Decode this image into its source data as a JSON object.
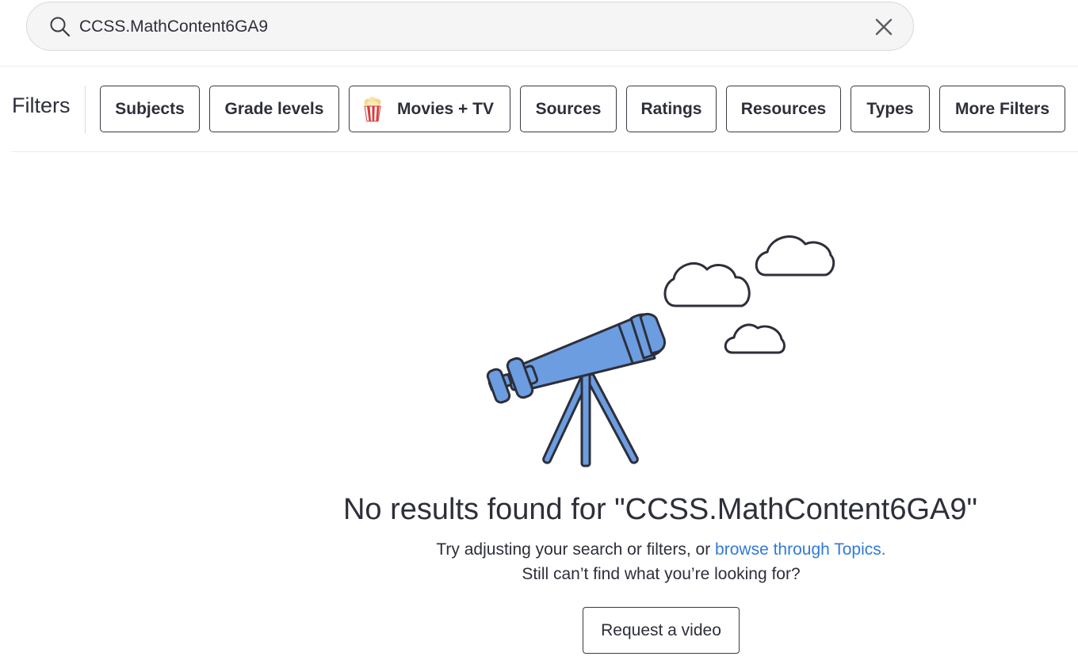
{
  "search": {
    "value": "CCSS.MathContent6GA9",
    "icon": "search-icon",
    "clear_icon": "close-icon"
  },
  "filters": {
    "label": "Filters",
    "chips": [
      {
        "label": "Subjects"
      },
      {
        "label": "Grade levels"
      },
      {
        "label": "Movies + TV",
        "icon": "popcorn-icon"
      },
      {
        "label": "Sources"
      },
      {
        "label": "Ratings"
      },
      {
        "label": "Resources"
      },
      {
        "label": "Types"
      },
      {
        "label": "More Filters"
      }
    ]
  },
  "empty_state": {
    "illustration": "telescope-with-clouds",
    "accent_color": "#6b9de0",
    "title": "No results found for \"CCSS.MathContent6GA9\"",
    "hint_prefix": "Try adjusting your search or filters, or ",
    "hint_link": "browse through Topics.",
    "hint_link_color": "#2f7bd8",
    "hint_line2": "Still can’t find what you’re looking for?",
    "request_button": "Request a video"
  }
}
